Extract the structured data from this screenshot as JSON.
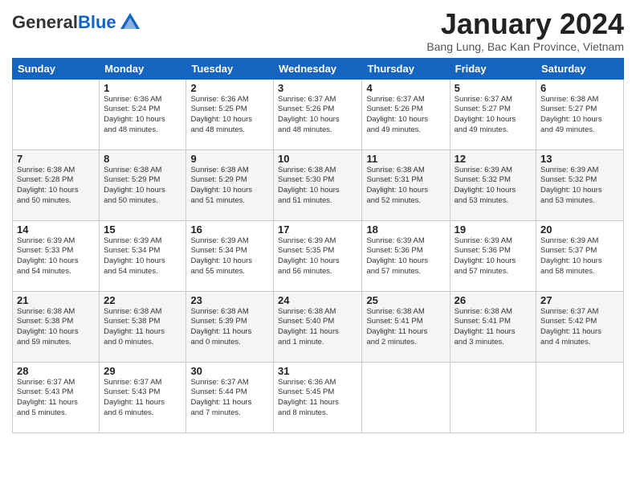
{
  "header": {
    "logo_general": "General",
    "logo_blue": "Blue",
    "month_title": "January 2024",
    "subtitle": "Bang Lung, Bac Kan Province, Vietnam"
  },
  "days_of_week": [
    "Sunday",
    "Monday",
    "Tuesday",
    "Wednesday",
    "Thursday",
    "Friday",
    "Saturday"
  ],
  "weeks": [
    [
      {
        "num": "",
        "info": ""
      },
      {
        "num": "1",
        "info": "Sunrise: 6:36 AM\nSunset: 5:24 PM\nDaylight: 10 hours\nand 48 minutes."
      },
      {
        "num": "2",
        "info": "Sunrise: 6:36 AM\nSunset: 5:25 PM\nDaylight: 10 hours\nand 48 minutes."
      },
      {
        "num": "3",
        "info": "Sunrise: 6:37 AM\nSunset: 5:26 PM\nDaylight: 10 hours\nand 48 minutes."
      },
      {
        "num": "4",
        "info": "Sunrise: 6:37 AM\nSunset: 5:26 PM\nDaylight: 10 hours\nand 49 minutes."
      },
      {
        "num": "5",
        "info": "Sunrise: 6:37 AM\nSunset: 5:27 PM\nDaylight: 10 hours\nand 49 minutes."
      },
      {
        "num": "6",
        "info": "Sunrise: 6:38 AM\nSunset: 5:27 PM\nDaylight: 10 hours\nand 49 minutes."
      }
    ],
    [
      {
        "num": "7",
        "info": "Sunrise: 6:38 AM\nSunset: 5:28 PM\nDaylight: 10 hours\nand 50 minutes."
      },
      {
        "num": "8",
        "info": "Sunrise: 6:38 AM\nSunset: 5:29 PM\nDaylight: 10 hours\nand 50 minutes."
      },
      {
        "num": "9",
        "info": "Sunrise: 6:38 AM\nSunset: 5:29 PM\nDaylight: 10 hours\nand 51 minutes."
      },
      {
        "num": "10",
        "info": "Sunrise: 6:38 AM\nSunset: 5:30 PM\nDaylight: 10 hours\nand 51 minutes."
      },
      {
        "num": "11",
        "info": "Sunrise: 6:38 AM\nSunset: 5:31 PM\nDaylight: 10 hours\nand 52 minutes."
      },
      {
        "num": "12",
        "info": "Sunrise: 6:39 AM\nSunset: 5:32 PM\nDaylight: 10 hours\nand 53 minutes."
      },
      {
        "num": "13",
        "info": "Sunrise: 6:39 AM\nSunset: 5:32 PM\nDaylight: 10 hours\nand 53 minutes."
      }
    ],
    [
      {
        "num": "14",
        "info": "Sunrise: 6:39 AM\nSunset: 5:33 PM\nDaylight: 10 hours\nand 54 minutes."
      },
      {
        "num": "15",
        "info": "Sunrise: 6:39 AM\nSunset: 5:34 PM\nDaylight: 10 hours\nand 54 minutes."
      },
      {
        "num": "16",
        "info": "Sunrise: 6:39 AM\nSunset: 5:34 PM\nDaylight: 10 hours\nand 55 minutes."
      },
      {
        "num": "17",
        "info": "Sunrise: 6:39 AM\nSunset: 5:35 PM\nDaylight: 10 hours\nand 56 minutes."
      },
      {
        "num": "18",
        "info": "Sunrise: 6:39 AM\nSunset: 5:36 PM\nDaylight: 10 hours\nand 57 minutes."
      },
      {
        "num": "19",
        "info": "Sunrise: 6:39 AM\nSunset: 5:36 PM\nDaylight: 10 hours\nand 57 minutes."
      },
      {
        "num": "20",
        "info": "Sunrise: 6:39 AM\nSunset: 5:37 PM\nDaylight: 10 hours\nand 58 minutes."
      }
    ],
    [
      {
        "num": "21",
        "info": "Sunrise: 6:38 AM\nSunset: 5:38 PM\nDaylight: 10 hours\nand 59 minutes."
      },
      {
        "num": "22",
        "info": "Sunrise: 6:38 AM\nSunset: 5:38 PM\nDaylight: 11 hours\nand 0 minutes."
      },
      {
        "num": "23",
        "info": "Sunrise: 6:38 AM\nSunset: 5:39 PM\nDaylight: 11 hours\nand 0 minutes."
      },
      {
        "num": "24",
        "info": "Sunrise: 6:38 AM\nSunset: 5:40 PM\nDaylight: 11 hours\nand 1 minute."
      },
      {
        "num": "25",
        "info": "Sunrise: 6:38 AM\nSunset: 5:41 PM\nDaylight: 11 hours\nand 2 minutes."
      },
      {
        "num": "26",
        "info": "Sunrise: 6:38 AM\nSunset: 5:41 PM\nDaylight: 11 hours\nand 3 minutes."
      },
      {
        "num": "27",
        "info": "Sunrise: 6:37 AM\nSunset: 5:42 PM\nDaylight: 11 hours\nand 4 minutes."
      }
    ],
    [
      {
        "num": "28",
        "info": "Sunrise: 6:37 AM\nSunset: 5:43 PM\nDaylight: 11 hours\nand 5 minutes."
      },
      {
        "num": "29",
        "info": "Sunrise: 6:37 AM\nSunset: 5:43 PM\nDaylight: 11 hours\nand 6 minutes."
      },
      {
        "num": "30",
        "info": "Sunrise: 6:37 AM\nSunset: 5:44 PM\nDaylight: 11 hours\nand 7 minutes."
      },
      {
        "num": "31",
        "info": "Sunrise: 6:36 AM\nSunset: 5:45 PM\nDaylight: 11 hours\nand 8 minutes."
      },
      {
        "num": "",
        "info": ""
      },
      {
        "num": "",
        "info": ""
      },
      {
        "num": "",
        "info": ""
      }
    ]
  ]
}
